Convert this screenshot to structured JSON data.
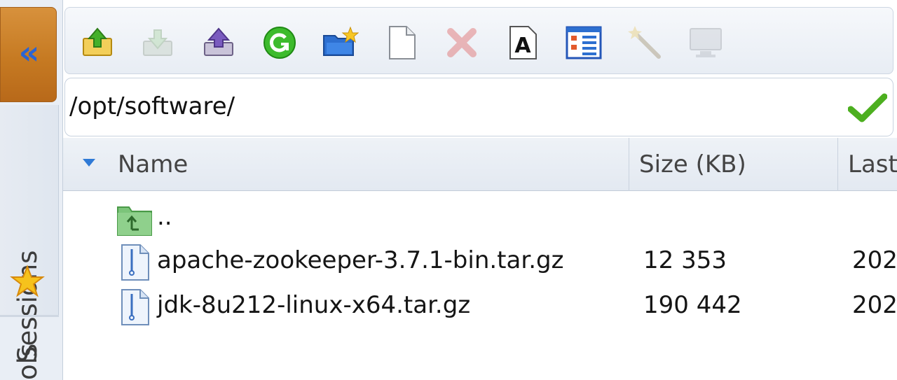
{
  "sidebar": {
    "collapse_glyph": "«",
    "tabs": [
      {
        "label": "Sessions",
        "icon": "star-icon"
      },
      {
        "label": "ols"
      }
    ]
  },
  "toolbar": {
    "buttons": [
      {
        "name": "upload-button",
        "icon": "upload-icon",
        "enabled": true
      },
      {
        "name": "download-button",
        "icon": "download-icon",
        "enabled": false
      },
      {
        "name": "upload-folder-button",
        "icon": "upload-folder-icon",
        "enabled": true
      },
      {
        "name": "refresh-button",
        "icon": "refresh-icon",
        "enabled": true
      },
      {
        "name": "new-folder-button",
        "icon": "new-folder-icon",
        "enabled": true
      },
      {
        "name": "new-file-button",
        "icon": "new-file-icon",
        "enabled": true
      },
      {
        "name": "delete-button",
        "icon": "delete-icon",
        "enabled": false
      },
      {
        "name": "text-editor-button",
        "icon": "text-icon",
        "enabled": true
      },
      {
        "name": "view-mode-button",
        "icon": "view-list-icon",
        "enabled": true
      },
      {
        "name": "magic-button",
        "icon": "magic-wand-icon",
        "enabled": false
      },
      {
        "name": "terminal-button",
        "icon": "monitor-icon",
        "enabled": false
      }
    ]
  },
  "path": {
    "value": "/opt/software/"
  },
  "columns": {
    "name": "Name",
    "size": "Size (KB)",
    "last": "Last"
  },
  "files": [
    {
      "name": "..",
      "size": "",
      "last": "",
      "type": "parent-folder"
    },
    {
      "name": "apache-zookeeper-3.7.1-bin.tar.gz",
      "size": "12 353",
      "last": "202",
      "type": "archive"
    },
    {
      "name": "jdk-8u212-linux-x64.tar.gz",
      "size": "190 442",
      "last": "202",
      "type": "archive"
    }
  ],
  "colors": {
    "accent_orange": "#c67a22",
    "accent_blue": "#2f7ad6",
    "check_green": "#4caf1f"
  }
}
